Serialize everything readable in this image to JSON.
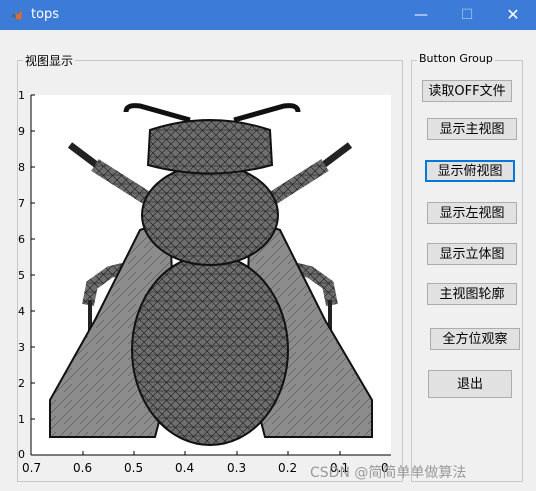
{
  "window": {
    "title": "tops",
    "min_glyph": "—",
    "max_glyph": "☐",
    "close_glyph": "✕"
  },
  "view_panel": {
    "label": "视图显示"
  },
  "button_group": {
    "label": "Button Group",
    "buttons": [
      "读取OFF文件",
      "显示主视图",
      "显示俯视图",
      "显示左视图",
      "显示立体图",
      "主视图轮廓",
      "全方位观察",
      "退出"
    ]
  },
  "axes": {
    "y_ticks": [
      "1",
      "9",
      "8",
      "7",
      "6",
      "5",
      "4",
      "3",
      "2",
      "1",
      "0"
    ],
    "x_ticks": [
      "0.7",
      "0.6",
      "0.5",
      "0.4",
      "0.3",
      "0.2",
      "0.1",
      "0"
    ]
  },
  "watermark": "CSDN @简简单单做算法"
}
